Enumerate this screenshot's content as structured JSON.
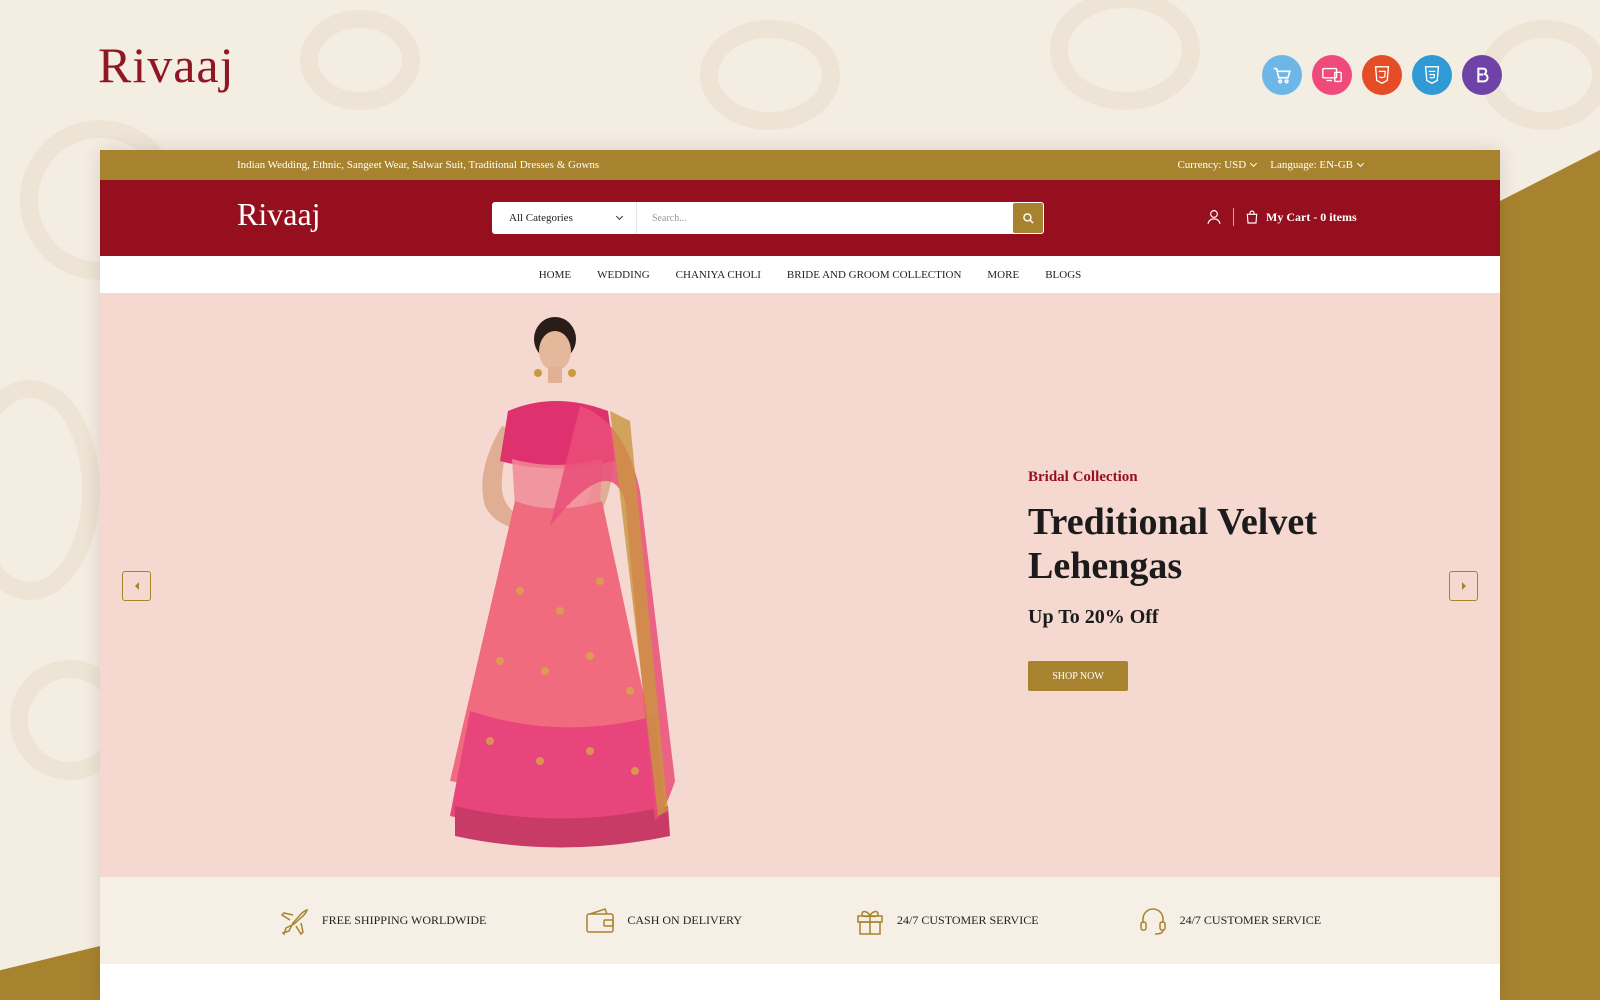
{
  "brand": "Rivaaj",
  "badges": [
    {
      "icon": "cart-icon",
      "color": "#6db7e8"
    },
    {
      "icon": "responsive-icon",
      "color": "#ef4a7a"
    },
    {
      "icon": "html5-icon",
      "color": "#e44d26",
      "label": "HTML"
    },
    {
      "icon": "css3-icon",
      "color": "#2f9ad6",
      "label": "CSS"
    },
    {
      "icon": "bootstrap-icon",
      "color": "#6f42a8",
      "label": "Bootstrap"
    }
  ],
  "topbar": {
    "tagline": "Indian Wedding, Ethnic, Sangeet Wear, Salwar Suit, Traditional Dresses & Gowns",
    "currency": "Currency: USD",
    "language": "Language: EN-GB"
  },
  "header": {
    "logo": "Rivaaj",
    "category_select": "All Categories",
    "search_placeholder": "Search...",
    "cart": "My Cart - 0 items"
  },
  "nav": [
    "HOME",
    "WEDDING",
    "CHANIYA CHOLI",
    "BRIDE AND GROOM COLLECTION",
    "MORE",
    "BLOGS"
  ],
  "hero": {
    "kicker": "Bridal Collection",
    "title": "Treditional Velvet Lehengas",
    "subtitle": "Up To 20% Off",
    "button": "SHOP NOW"
  },
  "features": [
    {
      "icon": "airplane-icon",
      "label": "FREE SHIPPING WORLDWIDE"
    },
    {
      "icon": "wallet-icon",
      "label": "CASH ON DELIVERY"
    },
    {
      "icon": "gift-icon",
      "label": "24/7 CUSTOMER SERVICE"
    },
    {
      "icon": "headset-icon",
      "label": "24/7 CUSTOMER SERVICE"
    }
  ],
  "colors": {
    "gold": "#a8832f",
    "maroon": "#950f1e",
    "hero_bg": "#f5d8d0",
    "page_bg": "#f4ede2"
  }
}
